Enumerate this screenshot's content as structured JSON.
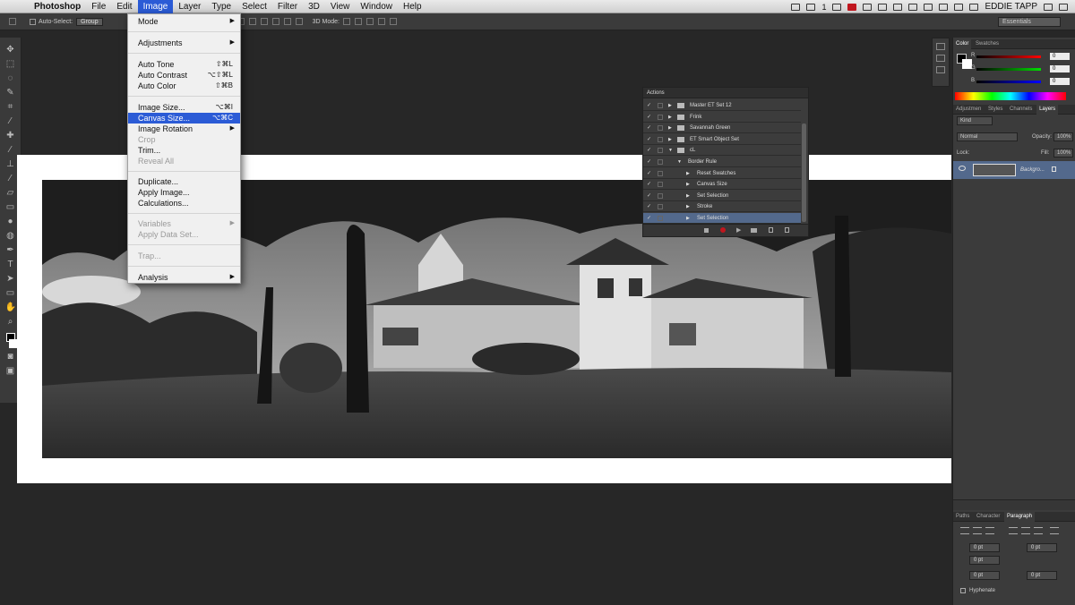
{
  "menubar": {
    "app_name": "Photoshop",
    "items": [
      "File",
      "Edit",
      "Image",
      "Layer",
      "Type",
      "Select",
      "Filter",
      "3D",
      "View",
      "Window",
      "Help"
    ],
    "active": "Image",
    "status_number": "1",
    "user": "EDDIE TAPP"
  },
  "options_bar": {
    "auto_select_label": "Auto-Select:",
    "auto_select_value": "Group",
    "mode_3d": "3D Mode:",
    "workspace": "Essentials"
  },
  "image_menu": {
    "items": [
      {
        "label": "Mode",
        "shortcut": "",
        "submenu": true,
        "enabled": true
      },
      {
        "label": "Adjustments",
        "shortcut": "",
        "submenu": true,
        "enabled": true
      },
      {
        "label": "Auto Tone",
        "shortcut": "⇧⌘L",
        "submenu": false,
        "enabled": true
      },
      {
        "label": "Auto Contrast",
        "shortcut": "⌥⇧⌘L",
        "submenu": false,
        "enabled": true
      },
      {
        "label": "Auto Color",
        "shortcut": "⇧⌘B",
        "submenu": false,
        "enabled": true
      },
      {
        "label": "Image Size...",
        "shortcut": "⌥⌘I",
        "submenu": false,
        "enabled": true
      },
      {
        "label": "Canvas Size...",
        "shortcut": "⌥⌘C",
        "submenu": false,
        "enabled": true,
        "highlighted": true
      },
      {
        "label": "Image Rotation",
        "shortcut": "",
        "submenu": true,
        "enabled": true
      },
      {
        "label": "Crop",
        "shortcut": "",
        "submenu": false,
        "enabled": false
      },
      {
        "label": "Trim...",
        "shortcut": "",
        "submenu": false,
        "enabled": true
      },
      {
        "label": "Reveal All",
        "shortcut": "",
        "submenu": false,
        "enabled": false
      },
      {
        "label": "Duplicate...",
        "shortcut": "",
        "submenu": false,
        "enabled": true
      },
      {
        "label": "Apply Image...",
        "shortcut": "",
        "submenu": false,
        "enabled": true
      },
      {
        "label": "Calculations...",
        "shortcut": "",
        "submenu": false,
        "enabled": true
      },
      {
        "label": "Variables",
        "shortcut": "",
        "submenu": true,
        "enabled": false
      },
      {
        "label": "Apply Data Set...",
        "shortcut": "",
        "submenu": false,
        "enabled": false
      },
      {
        "label": "Trap...",
        "shortcut": "",
        "submenu": false,
        "enabled": false
      },
      {
        "label": "Analysis",
        "shortcut": "",
        "submenu": true,
        "enabled": true
      }
    ]
  },
  "actions_panel": {
    "title": "Actions",
    "rows": [
      {
        "label": "Master ET Set 12",
        "indent": 0,
        "folder": true,
        "expanded": false,
        "selected": false
      },
      {
        "label": "Frink",
        "indent": 0,
        "folder": true,
        "expanded": false,
        "selected": false
      },
      {
        "label": "Savannah Green",
        "indent": 0,
        "folder": true,
        "expanded": false,
        "selected": false
      },
      {
        "label": "ET Smart Object Set",
        "indent": 0,
        "folder": true,
        "expanded": false,
        "selected": false
      },
      {
        "label": "cL",
        "indent": 0,
        "folder": true,
        "expanded": true,
        "selected": false
      },
      {
        "label": "Border Rule",
        "indent": 1,
        "folder": false,
        "expanded": true,
        "selected": false
      },
      {
        "label": "Reset Swatches",
        "indent": 2,
        "folder": false,
        "expanded": false,
        "selected": false
      },
      {
        "label": "Canvas Size",
        "indent": 2,
        "folder": false,
        "expanded": false,
        "selected": false
      },
      {
        "label": "Set Selection",
        "indent": 2,
        "folder": false,
        "expanded": false,
        "selected": false
      },
      {
        "label": "Stroke",
        "indent": 2,
        "folder": false,
        "expanded": false,
        "selected": false
      },
      {
        "label": "Set Selection",
        "indent": 2,
        "folder": false,
        "expanded": false,
        "selected": true
      }
    ]
  },
  "color_panel": {
    "tabs": [
      "Color",
      "Swatches"
    ],
    "channels": [
      {
        "name": "R",
        "value": "0"
      },
      {
        "name": "G",
        "value": "0"
      },
      {
        "name": "B",
        "value": "0"
      }
    ]
  },
  "layers_panel": {
    "tabs": [
      "Adjustmen",
      "Styles",
      "Channels",
      "Layers"
    ],
    "filter_label": "Kind",
    "blend_mode": "Normal",
    "opacity_label": "Opacity:",
    "opacity_value": "100%",
    "lock_label": "Lock:",
    "fill_label": "Fill:",
    "fill_value": "100%",
    "layer_name": "Backgro..."
  },
  "paragraph_panel": {
    "tabs": [
      "Paths",
      "Character",
      "Paragraph"
    ],
    "indent_left": "0 pt",
    "indent_right": "0 pt",
    "indent_first": "0 pt",
    "space_before": "0 pt",
    "space_after": "0 pt",
    "hyphenate_label": "Hyphenate"
  }
}
